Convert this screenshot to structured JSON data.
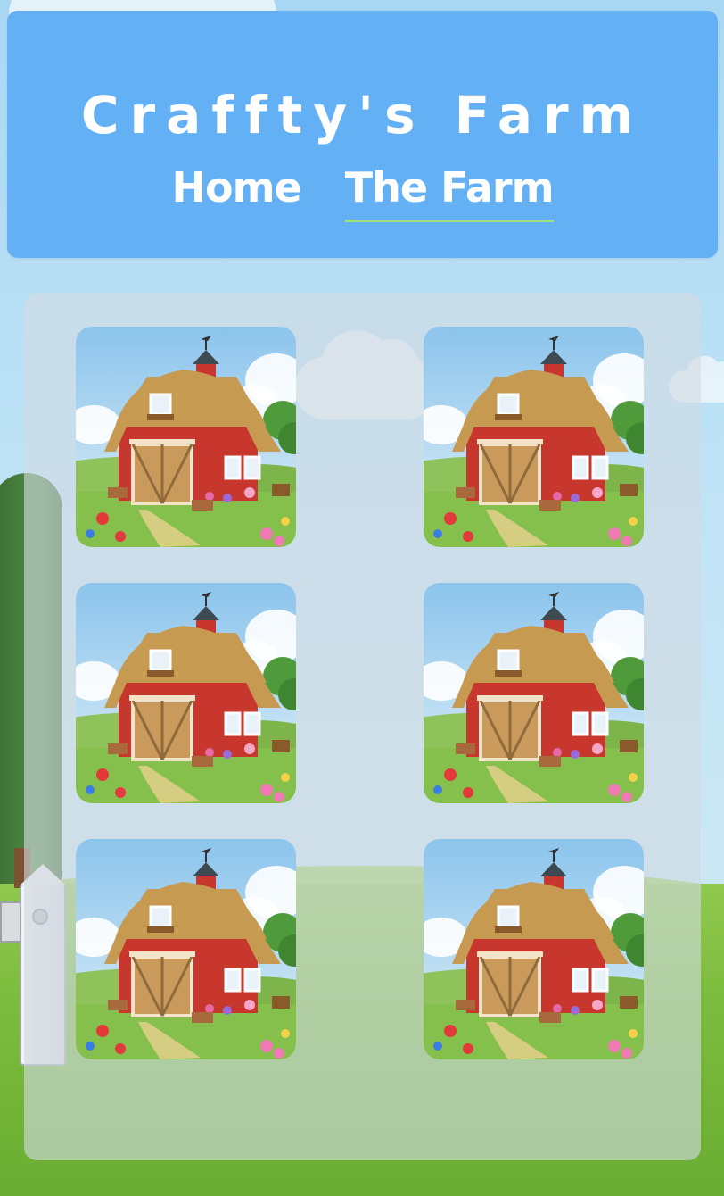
{
  "header": {
    "title": "Craffty's Farm",
    "nav": [
      {
        "label": "Home",
        "active": false
      },
      {
        "label": "The Farm",
        "active": true
      }
    ]
  },
  "gallery": {
    "items": [
      {
        "image": "red-barn-illustration"
      },
      {
        "image": "red-barn-illustration"
      },
      {
        "image": "red-barn-illustration"
      },
      {
        "image": "red-barn-illustration"
      },
      {
        "image": "red-barn-illustration"
      },
      {
        "image": "red-barn-illustration"
      }
    ]
  },
  "colors": {
    "header_bg": "#64b0f4",
    "active_underline": "#9ee07a",
    "barn_red": "#c8372d",
    "roof_thatch": "#c79a52"
  }
}
